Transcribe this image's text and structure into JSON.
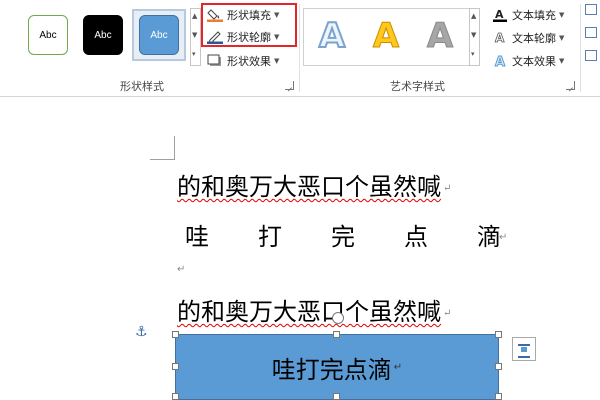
{
  "ribbon": {
    "shape_styles": {
      "label": "形状样式",
      "swatches": [
        "Abc",
        "Abc",
        "Abc"
      ],
      "shape_fill": "形状填充",
      "shape_outline": "形状轮廓",
      "shape_effects": "形状效果"
    },
    "wordart_styles": {
      "label": "艺术字样式",
      "samples": [
        "A",
        "A",
        "A"
      ],
      "text_fill": "文本填充",
      "text_outline": "文本轮廓",
      "text_effects": "文本效果"
    }
  },
  "document": {
    "line1": "的和奥万大恶口个虽然喊",
    "line2": [
      "哇",
      "打",
      "完",
      "点",
      "滴"
    ],
    "line4": "的和奥万大恶口个虽然喊",
    "shape_text": "哇打完点滴"
  },
  "colors": {
    "highlight_box": "#e3262a",
    "shape_fill": "#5b9bd5",
    "shape_border": "#41719c"
  }
}
